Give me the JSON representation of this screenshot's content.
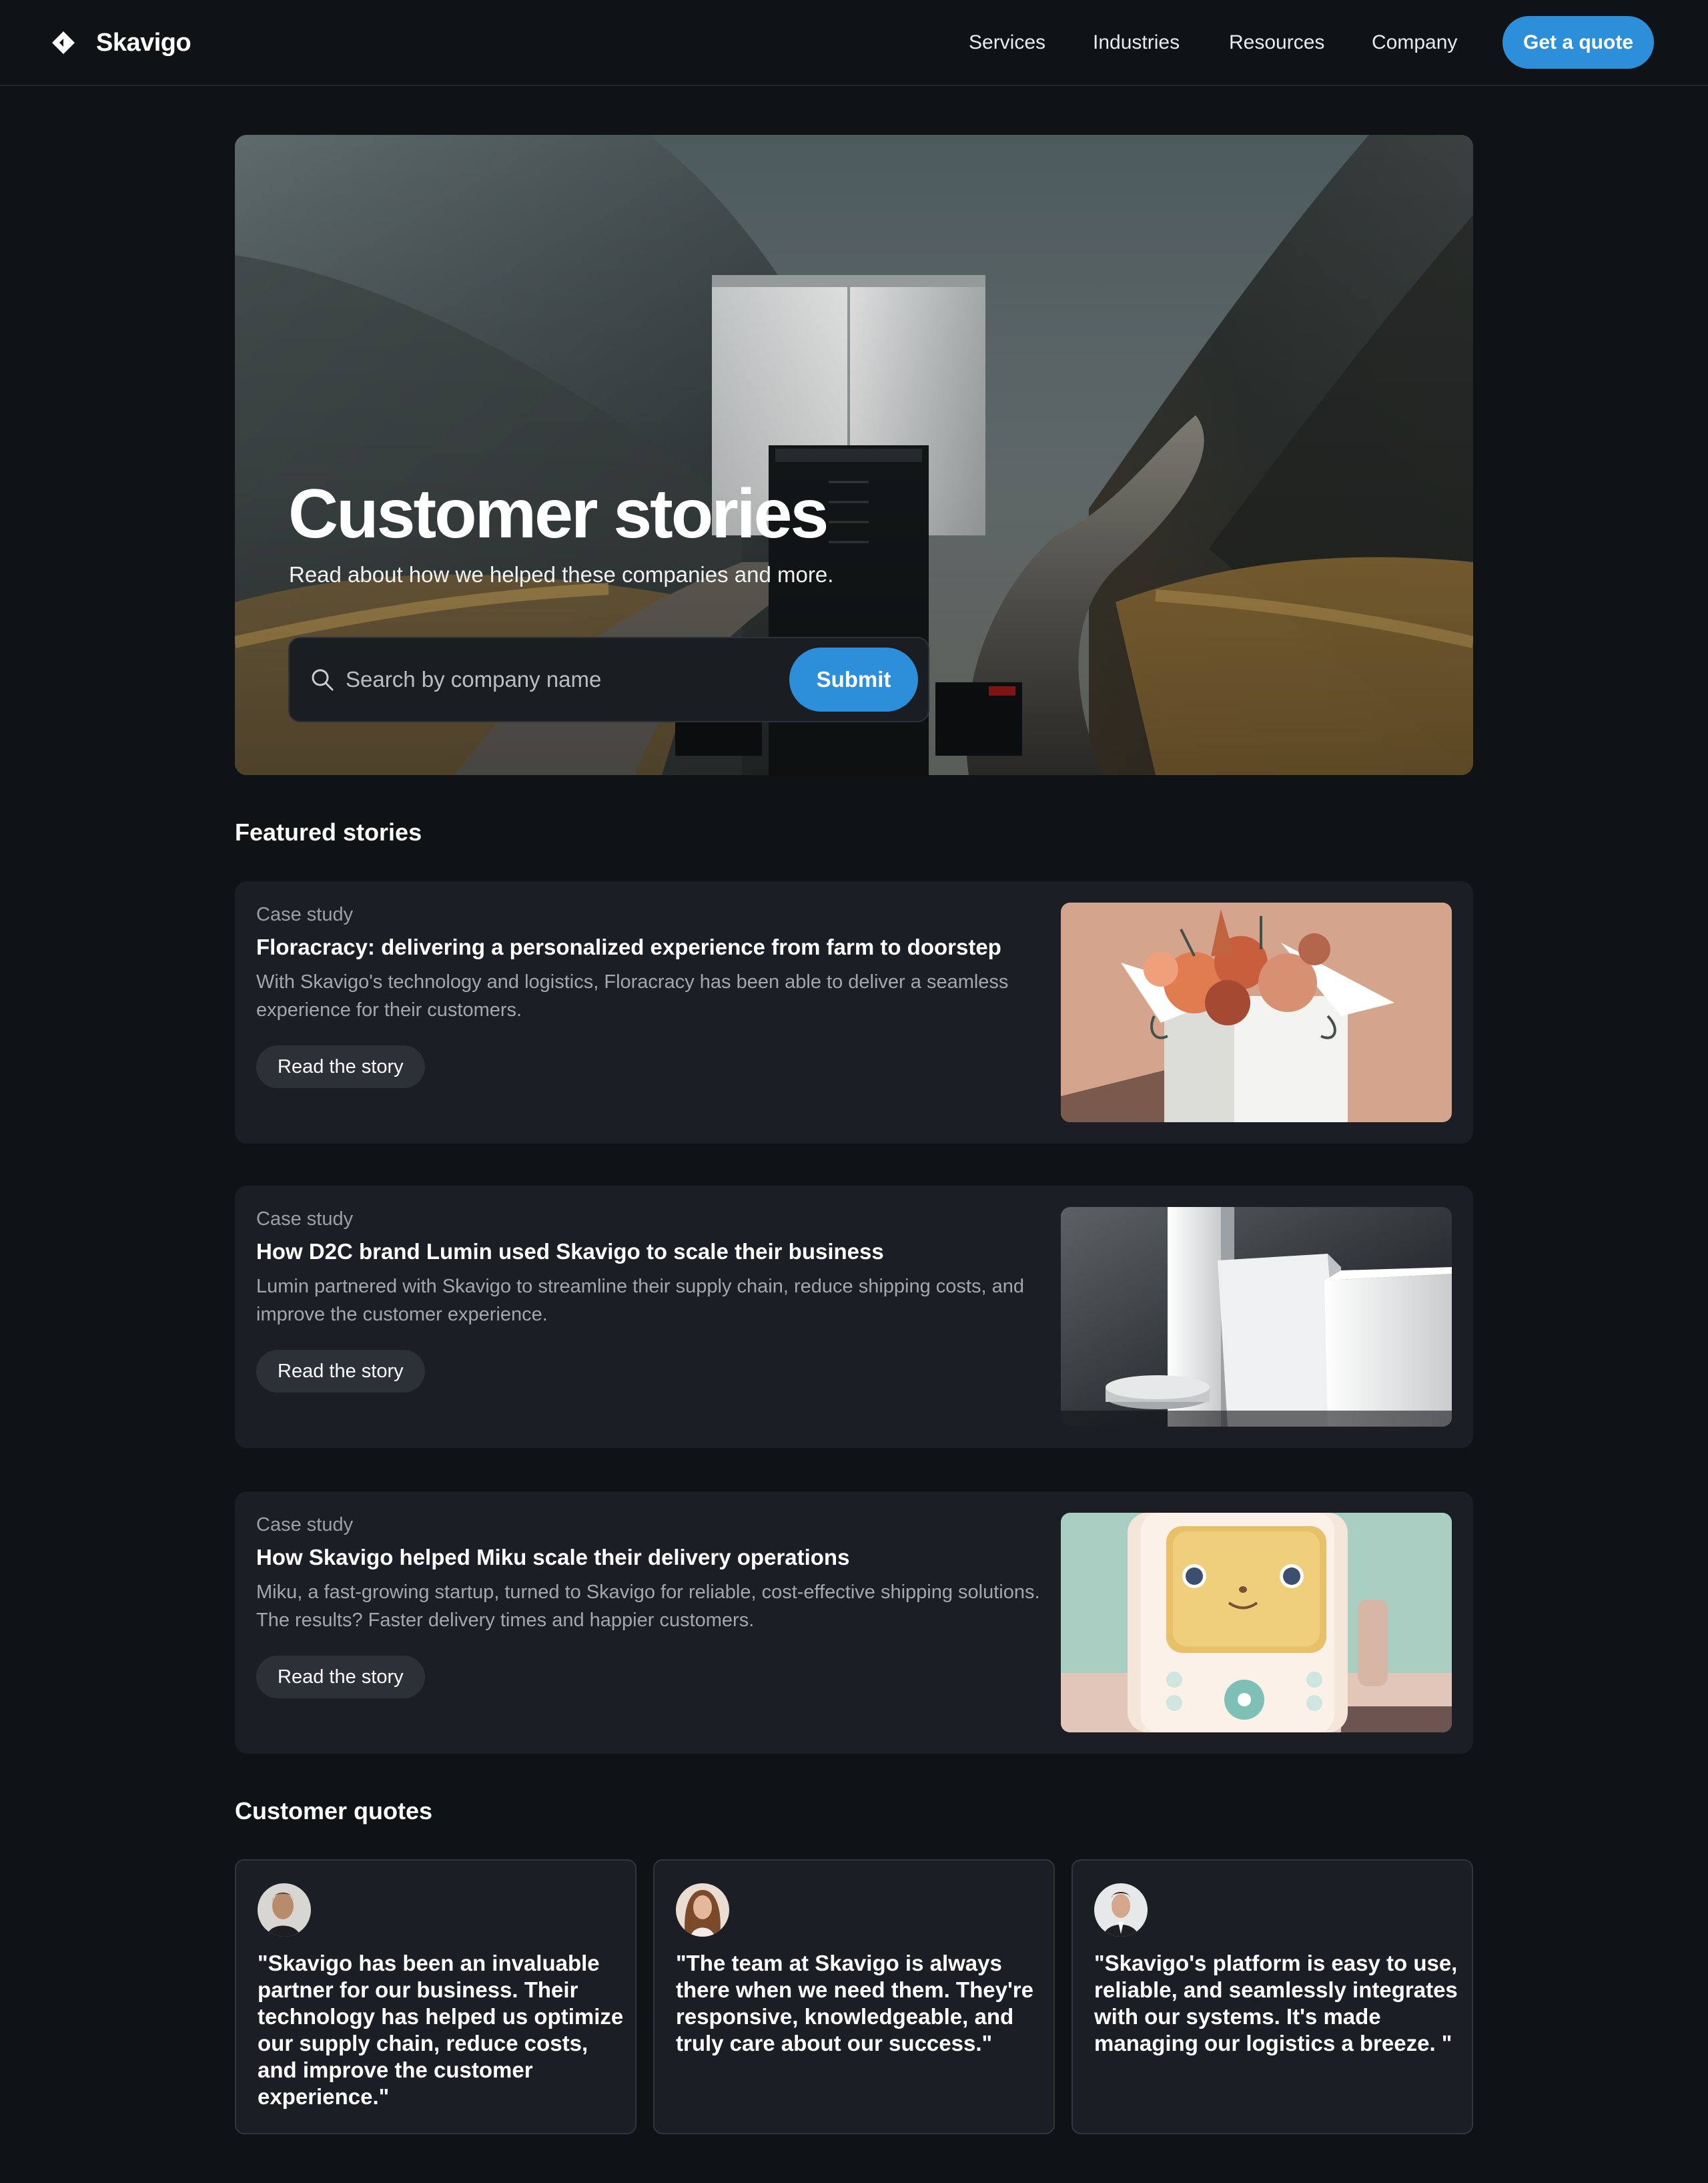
{
  "nav": {
    "brand": "Skavigo",
    "links": [
      "Services",
      "Industries",
      "Resources",
      "Company"
    ],
    "cta_label": "Get a quote"
  },
  "hero": {
    "title": "Customer stories",
    "subtitle": "Read about how we helped these companies and more.",
    "search": {
      "placeholder": "Search by company name",
      "value": ""
    },
    "submit_label": "Submit"
  },
  "featured": {
    "heading": "Featured stories",
    "stories": [
      {
        "tag": "Case study",
        "title": "Floracracy: delivering a personalized experience from farm to doorstep",
        "description": "With Skavigo's technology and logistics, Floracracy has been able to deliver a seamless experience for their customers.",
        "button_label": "Read the story"
      },
      {
        "tag": "Case study",
        "title": "How D2C brand Lumin used Skavigo to scale their business",
        "description": "Lumin partnered with Skavigo to streamline their supply chain, reduce shipping costs, and improve the customer experience.",
        "button_label": "Read the story"
      },
      {
        "tag": "Case study",
        "title": "How Skavigo helped Miku scale their delivery operations",
        "description": "Miku, a fast-growing startup, turned to Skavigo for reliable, cost-effective shipping solutions. The results? Faster delivery times and happier customers.",
        "button_label": "Read the story"
      }
    ]
  },
  "quotes": {
    "heading": "Customer quotes",
    "items": [
      {
        "text": "\"Skavigo has been an invaluable partner for our business. Their technology has helped us optimize our supply chain, reduce costs, and improve the customer experience.\""
      },
      {
        "text": "\"The team at Skavigo is always there when we need them. They're responsive, knowledgeable, and truly care about our success.\""
      },
      {
        "text": "\"Skavigo's platform is easy to use, reliable, and seamlessly integrates with our systems. It's made managing our logistics a breeze. \""
      }
    ]
  },
  "colors": {
    "background": "#0f1316",
    "card": "#1b1f25",
    "accent": "#2d8fd9",
    "muted_text": "#a2a8ae"
  },
  "icons": [
    "brand-logo-icon",
    "search-icon"
  ]
}
